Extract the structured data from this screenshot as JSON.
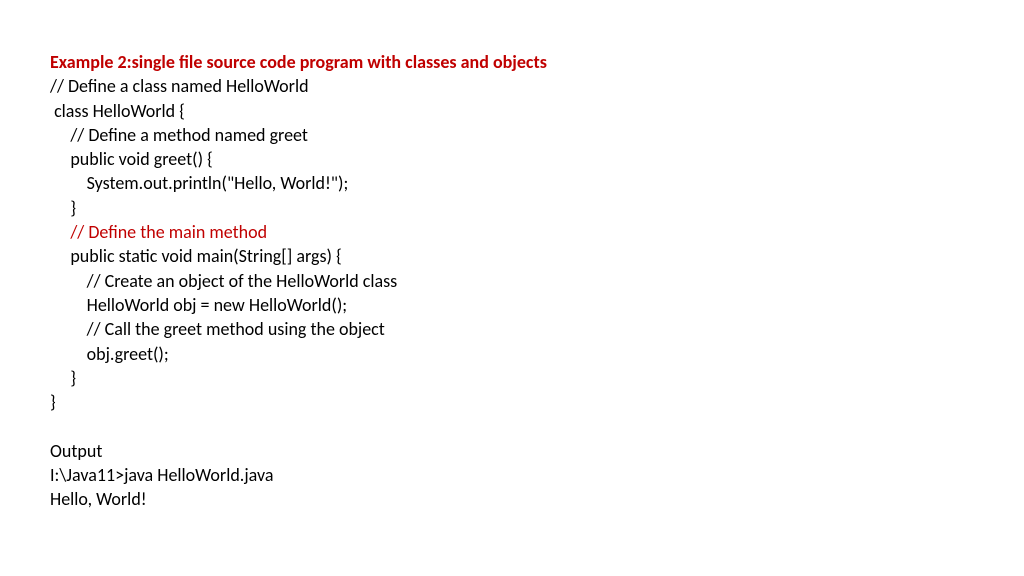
{
  "title": "Example 2:single file source code program with classes and objects",
  "code": {
    "l1": "// Define a class named HelloWorld",
    "l2": " class HelloWorld {",
    "l3": "     // Define a method named greet",
    "l4": "     public void greet() {",
    "l5": "         System.out.println(\"Hello, World!\");",
    "l6": "     }",
    "l7": "     // Define the main method",
    "l8": "     public static void main(String[] args) {",
    "l9": "         // Create an object of the HelloWorld class",
    "l10": "         HelloWorld obj = new HelloWorld();",
    "l11": "         // Call the greet method using the object",
    "l12": "         obj.greet();",
    "l13": "     }",
    "l14": "}"
  },
  "output": {
    "label": "Output",
    "l1": "I:\\Java11>java HelloWorld.java",
    "l2": "Hello, World!"
  }
}
